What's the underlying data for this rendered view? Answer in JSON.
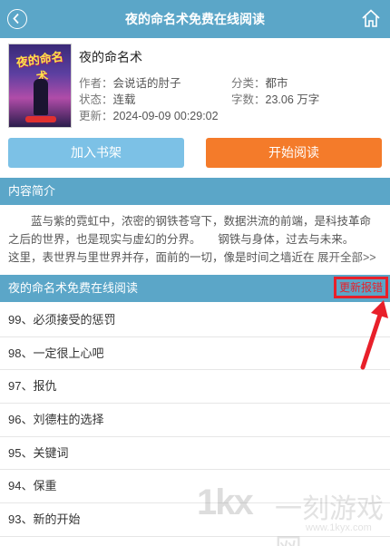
{
  "header": {
    "title": "夜的命名术免费在线阅读",
    "back_icon": "back-icon",
    "home_icon": "home-icon"
  },
  "book": {
    "name": "夜的命名术",
    "cover_title": "夜的命名术",
    "author_label": "作者：",
    "author": "会说话的肘子",
    "category_label": "分类：",
    "category": "都市",
    "status_label": "状态：",
    "status": "连载",
    "words_label": "字数：",
    "words": "23.06 万字",
    "updated_label": "更新：",
    "updated": "2024-09-09 00:29:02"
  },
  "actions": {
    "add_shelf": "加入书架",
    "start_read": "开始阅读"
  },
  "intro": {
    "heading": "内容简介",
    "text": "蓝与紫的霓虹中，浓密的钢铁苍穹下，数据洪流的前端，是科技革命之后的世界，也是现实与虚幻的分界。　　钢铁与身体，过去与未来。　　这里，表世界与里世界并存，面前的一切，像是时间之墙近在",
    "more": "展开全部>>"
  },
  "chapters_section": {
    "heading": "夜的命名术免费在线阅读",
    "report": "更新报错",
    "items": [
      "99、必须接受的惩罚",
      "98、一定很上心吧",
      "97、报仇",
      "96、刘德柱的选择",
      "95、关键词",
      "94、保重",
      "93、新的开始"
    ]
  },
  "watermark": {
    "logo": "1kx",
    "name": "一刻游戏网",
    "url": "www.1kyx.com"
  },
  "colors": {
    "bar": "#5ba6c8",
    "shelf_button": "#7cc1e6",
    "read_button": "#f47b2a",
    "annotation": "#e8202a"
  }
}
